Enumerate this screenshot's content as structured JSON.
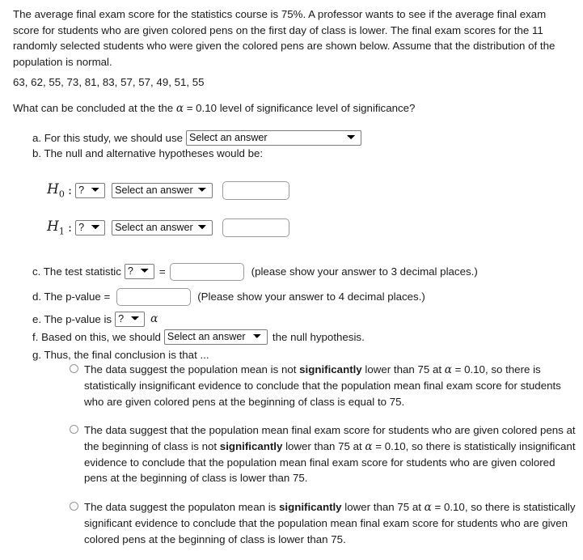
{
  "problem": {
    "intro": "The average final exam score for the statistics course is 75%. A professor wants to see if the average final exam score for students who are given colored pens on the first day of class is lower. The final exam scores for the 11 randomly selected students who were given the colored pens are shown below. Assume that the distribution of the population is normal.",
    "data_values": "63, 62, 55, 73, 81, 83, 57, 57, 49, 51, 55",
    "question_prefix": "What can be concluded at the the ",
    "alpha_symbol": "α",
    "question_suffix": " = 0.10 level of significance level of significance?"
  },
  "steps": {
    "a_label": "a. For this study, we should use",
    "a_select_value": "Select an answer",
    "b_label": "b. The null and alternative hypotheses would be:",
    "c_label": "c. The test statistic",
    "c_param_select": "?",
    "c_equals": "=",
    "c_input_value": "",
    "c_hint": "(please show your answer to 3 decimal places.)",
    "d_label": "d. The p-value =",
    "d_input_value": "",
    "d_hint": "(Please show your answer to 4 decimal places.)",
    "e_label": "e. The p-value is",
    "e_select_value": "?",
    "e_alpha": "α",
    "f_label": "f. Based on this, we should",
    "f_select_value": "Select an answer",
    "f_tail": "the null hypothesis.",
    "g_label": "g. Thus, the final conclusion is that ..."
  },
  "hypotheses": [
    {
      "symbol": "H",
      "subscript": "0",
      "colon": ":",
      "param_select": "?",
      "relation_select": "Select an answer",
      "value_input": ""
    },
    {
      "symbol": "H",
      "subscript": "1",
      "colon": ":",
      "param_select": "?",
      "relation_select": "Select an answer",
      "value_input": ""
    }
  ],
  "conclusion_options": [
    {
      "part1": "The data suggest the population mean is not ",
      "emphasis": "significantly",
      "part2": " lower than 75 at ",
      "alpha": "α",
      "part3": " = 0.10, so there is statistically insignificant evidence to conclude that the population mean final exam score for students who are given colored pens at the beginning of class is equal to 75.",
      "selected": false
    },
    {
      "part1": "The data suggest that the population mean final exam score for students who are given colored pens at the beginning of class is not ",
      "emphasis": "significantly",
      "part2": " lower than 75 at ",
      "alpha": "α",
      "part3": " = 0.10, so there is statistically insignificant evidence to conclude that the population mean final exam score for students who are given colored pens at the beginning of class is lower than 75.",
      "selected": false
    },
    {
      "part1": "The data suggest the populaton mean is ",
      "emphasis": "significantly",
      "part2": " lower than 75 at ",
      "alpha": "α",
      "part3": " = 0.10, so there is statistically significant evidence to conclude that the population mean final exam score for students who are given colored pens at the beginning of class is lower than 75.",
      "selected": false
    }
  ]
}
